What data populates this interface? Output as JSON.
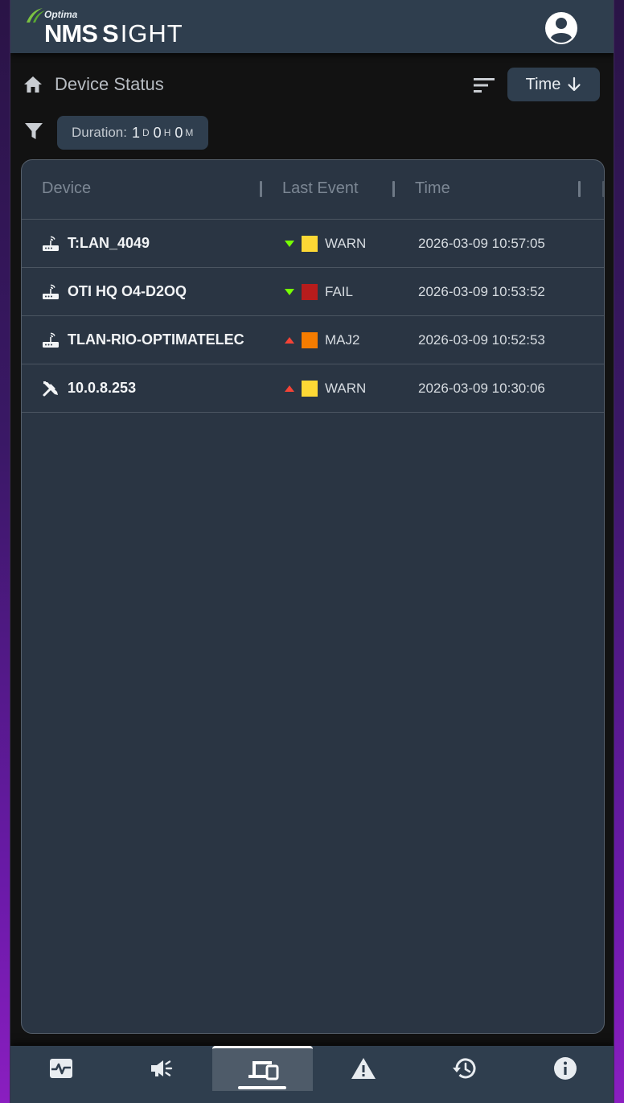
{
  "header": {
    "logo_brand": "Optima",
    "logo_nms": "NMS",
    "logo_sight": "IGHT",
    "avatar_icon": "account-circle-icon"
  },
  "toolbar": {
    "page_title": "Device Status",
    "sort_label": "Time",
    "sort_direction_icon": "arrow-down-icon",
    "duration_label": "Duration:",
    "duration_days": "1",
    "duration_days_unit": "D",
    "duration_hours": "0",
    "duration_hours_unit": "H",
    "duration_minutes": "0",
    "duration_minutes_unit": "M"
  },
  "table": {
    "columns": [
      "Device",
      "Last Event",
      "Time"
    ],
    "rows": [
      {
        "icon": "router-icon",
        "device": "T:LAN_4049",
        "trend": "down",
        "severity_color": "#fdd835",
        "event": "WARN",
        "time": "2026-03-09 10:57:05"
      },
      {
        "icon": "router-icon",
        "device": "OTI HQ O4-D2OQ",
        "trend": "down",
        "severity_color": "#b71c1c",
        "event": "FAIL",
        "time": "2026-03-09 10:53:52"
      },
      {
        "icon": "router-icon",
        "device": "TLAN-RIO-OPTIMATELECOM",
        "trend": "up",
        "severity_color": "#f57c00",
        "event": "MAJ2",
        "time": "2026-03-09 10:52:53"
      },
      {
        "icon": "tools-icon",
        "device": "10.0.8.253",
        "trend": "up",
        "severity_color": "#fdd835",
        "event": "WARN",
        "time": "2026-03-09 10:30:06"
      }
    ]
  },
  "bottom_nav": [
    {
      "icon": "monitor-heart-icon",
      "active": false
    },
    {
      "icon": "campaign-icon",
      "active": false
    },
    {
      "icon": "devices-icon",
      "active": true
    },
    {
      "icon": "warning-icon",
      "active": false
    },
    {
      "icon": "history-icon",
      "active": false
    },
    {
      "icon": "info-icon",
      "active": false
    }
  ],
  "colors": {
    "trend_down": "#76ff03",
    "trend_up": "#f44336",
    "header_bg": "#2f3e4e"
  }
}
